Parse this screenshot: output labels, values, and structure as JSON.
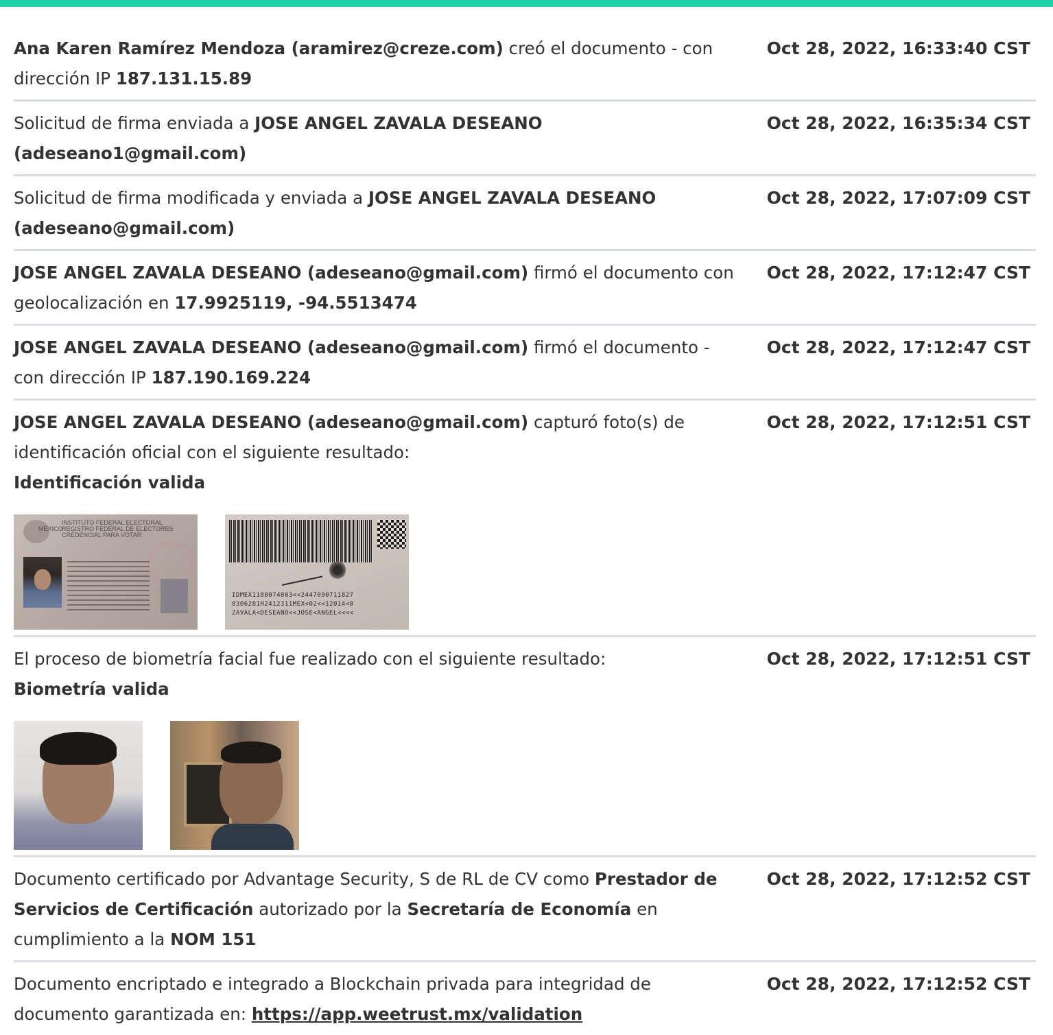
{
  "accent_color": "#1fd1a7",
  "entries": [
    {
      "bold1": "Ana Karen Ramírez Mendoza (aramirez@creze.com)",
      "text1": " creó el documento - con dirección IP ",
      "bold2": "187.131.15.89",
      "time": "Oct 28, 2022, 16:33:40 CST"
    },
    {
      "text1": "Solicitud de firma enviada a ",
      "bold1": "JOSE ANGEL ZAVALA DESEANO (adeseano1@gmail.com)",
      "time": "Oct 28, 2022, 16:35:34 CST"
    },
    {
      "text1": "Solicitud de firma modificada y enviada a ",
      "bold1": "JOSE ANGEL ZAVALA DESEANO (adeseano@gmail.com)",
      "time": "Oct 28, 2022, 17:07:09 CST"
    },
    {
      "bold1": "JOSE ANGEL ZAVALA DESEANO (adeseano@gmail.com)",
      "text1": " firmó el documento con geolocalización en ",
      "bold2": "17.9925119, -94.5513474",
      "time": "Oct 28, 2022, 17:12:47 CST"
    },
    {
      "bold1": "JOSE ANGEL ZAVALA DESEANO (adeseano@gmail.com)",
      "text1": " firmó el documento - con dirección IP ",
      "bold2": "187.190.169.224",
      "time": "Oct 28, 2022, 17:12:47 CST"
    },
    {
      "bold1": "JOSE ANGEL ZAVALA DESEANO (adeseano@gmail.com)",
      "text1": " capturó foto(s) de identificación oficial con el siguiente resultado:",
      "bold2": "Identificación valida",
      "time": "Oct 28, 2022, 17:12:51 CST",
      "id_front_lines": [
        "MÉXICO",
        "INSTITUTO FEDERAL ELECTORAL",
        "REGISTRO FEDERAL DE ELECTORES",
        "CREDENCIAL PARA VOTAR"
      ],
      "mrz_lines": [
        "IDMEX1188074803<<2447090711827",
        "8306281H2412311MEX<02<<12014<8",
        "ZAVALA<DESEANO<<JOSE<ANGEL<<<<"
      ]
    },
    {
      "text1": "El proceso de biometría facial fue realizado con el siguiente resultado:",
      "bold1": "Biometría valida",
      "time": "Oct 28, 2022, 17:12:51 CST"
    },
    {
      "text1": "Documento certificado por Advantage Security, S de RL de CV como ",
      "bold1": "Prestador de Servicios de Certificación",
      "text2": " autorizado por la ",
      "bold2": "Secretaría de Economía",
      "text3": " en cumplimiento a la ",
      "bold3": "NOM 151",
      "time": "Oct 28, 2022, 17:12:52 CST"
    },
    {
      "text1": "Documento encriptado e integrado a Blockchain privada para integridad de documento garantizada en: ",
      "link": "https://app.weetrust.mx/validation",
      "time": "Oct 28, 2022, 17:12:52 CST"
    }
  ]
}
